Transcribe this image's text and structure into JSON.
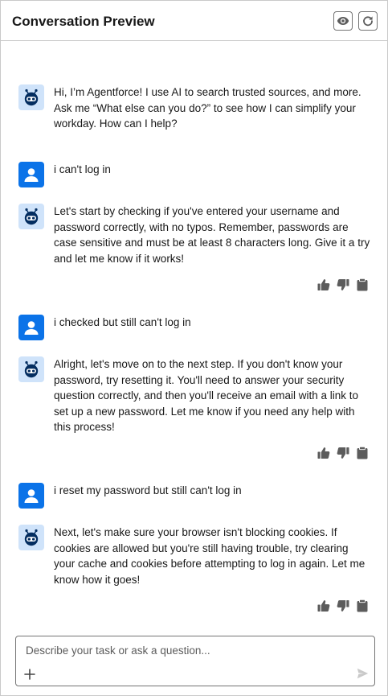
{
  "header": {
    "title": "Conversation Preview",
    "preview_icon": "eye-icon",
    "refresh_icon": "refresh-icon"
  },
  "messages": [
    {
      "role": "agent",
      "text": "Hi, I’m Agentforce! I use AI to search trusted sources, and more. Ask me “What else can you do?” to see how I can simplify your workday. How can I help?"
    },
    {
      "role": "user",
      "text": "i can't log in"
    },
    {
      "role": "agent",
      "text": "Let's start by checking if you've entered your username and password correctly, with no typos. Remember, passwords are case sensitive and must be at least 8 characters long. Give it a try and let me know if it works!"
    },
    {
      "role": "user",
      "text": "i checked but still can't log in"
    },
    {
      "role": "agent",
      "text": "Alright, let's move on to the next step. If you don't know your password, try resetting it. You'll need to answer your security question correctly, and then you'll receive an email with a link to set up a new password. Let me know if you need any help with this process!"
    },
    {
      "role": "user",
      "text": "i reset my password but still can't log in"
    },
    {
      "role": "agent",
      "text": "Next, let's make sure your browser isn't blocking cookies. If cookies are allowed but you're still having trouble, try clearing your cache and cookies before attempting to log in again. Let me know how it goes!"
    }
  ],
  "message_actions": [
    "thumbs-up-icon",
    "thumbs-down-icon",
    "clipboard-icon"
  ],
  "composer": {
    "placeholder": "Describe your task or ask a question...",
    "value": "",
    "add_icon": "plus-icon",
    "send_icon": "send-icon"
  },
  "colors": {
    "user_avatar": "#0b73e8",
    "agent_avatar_bg": "#cfe3fa",
    "agent_icon": "#032d60",
    "action_icon": "#5c5c5c"
  }
}
